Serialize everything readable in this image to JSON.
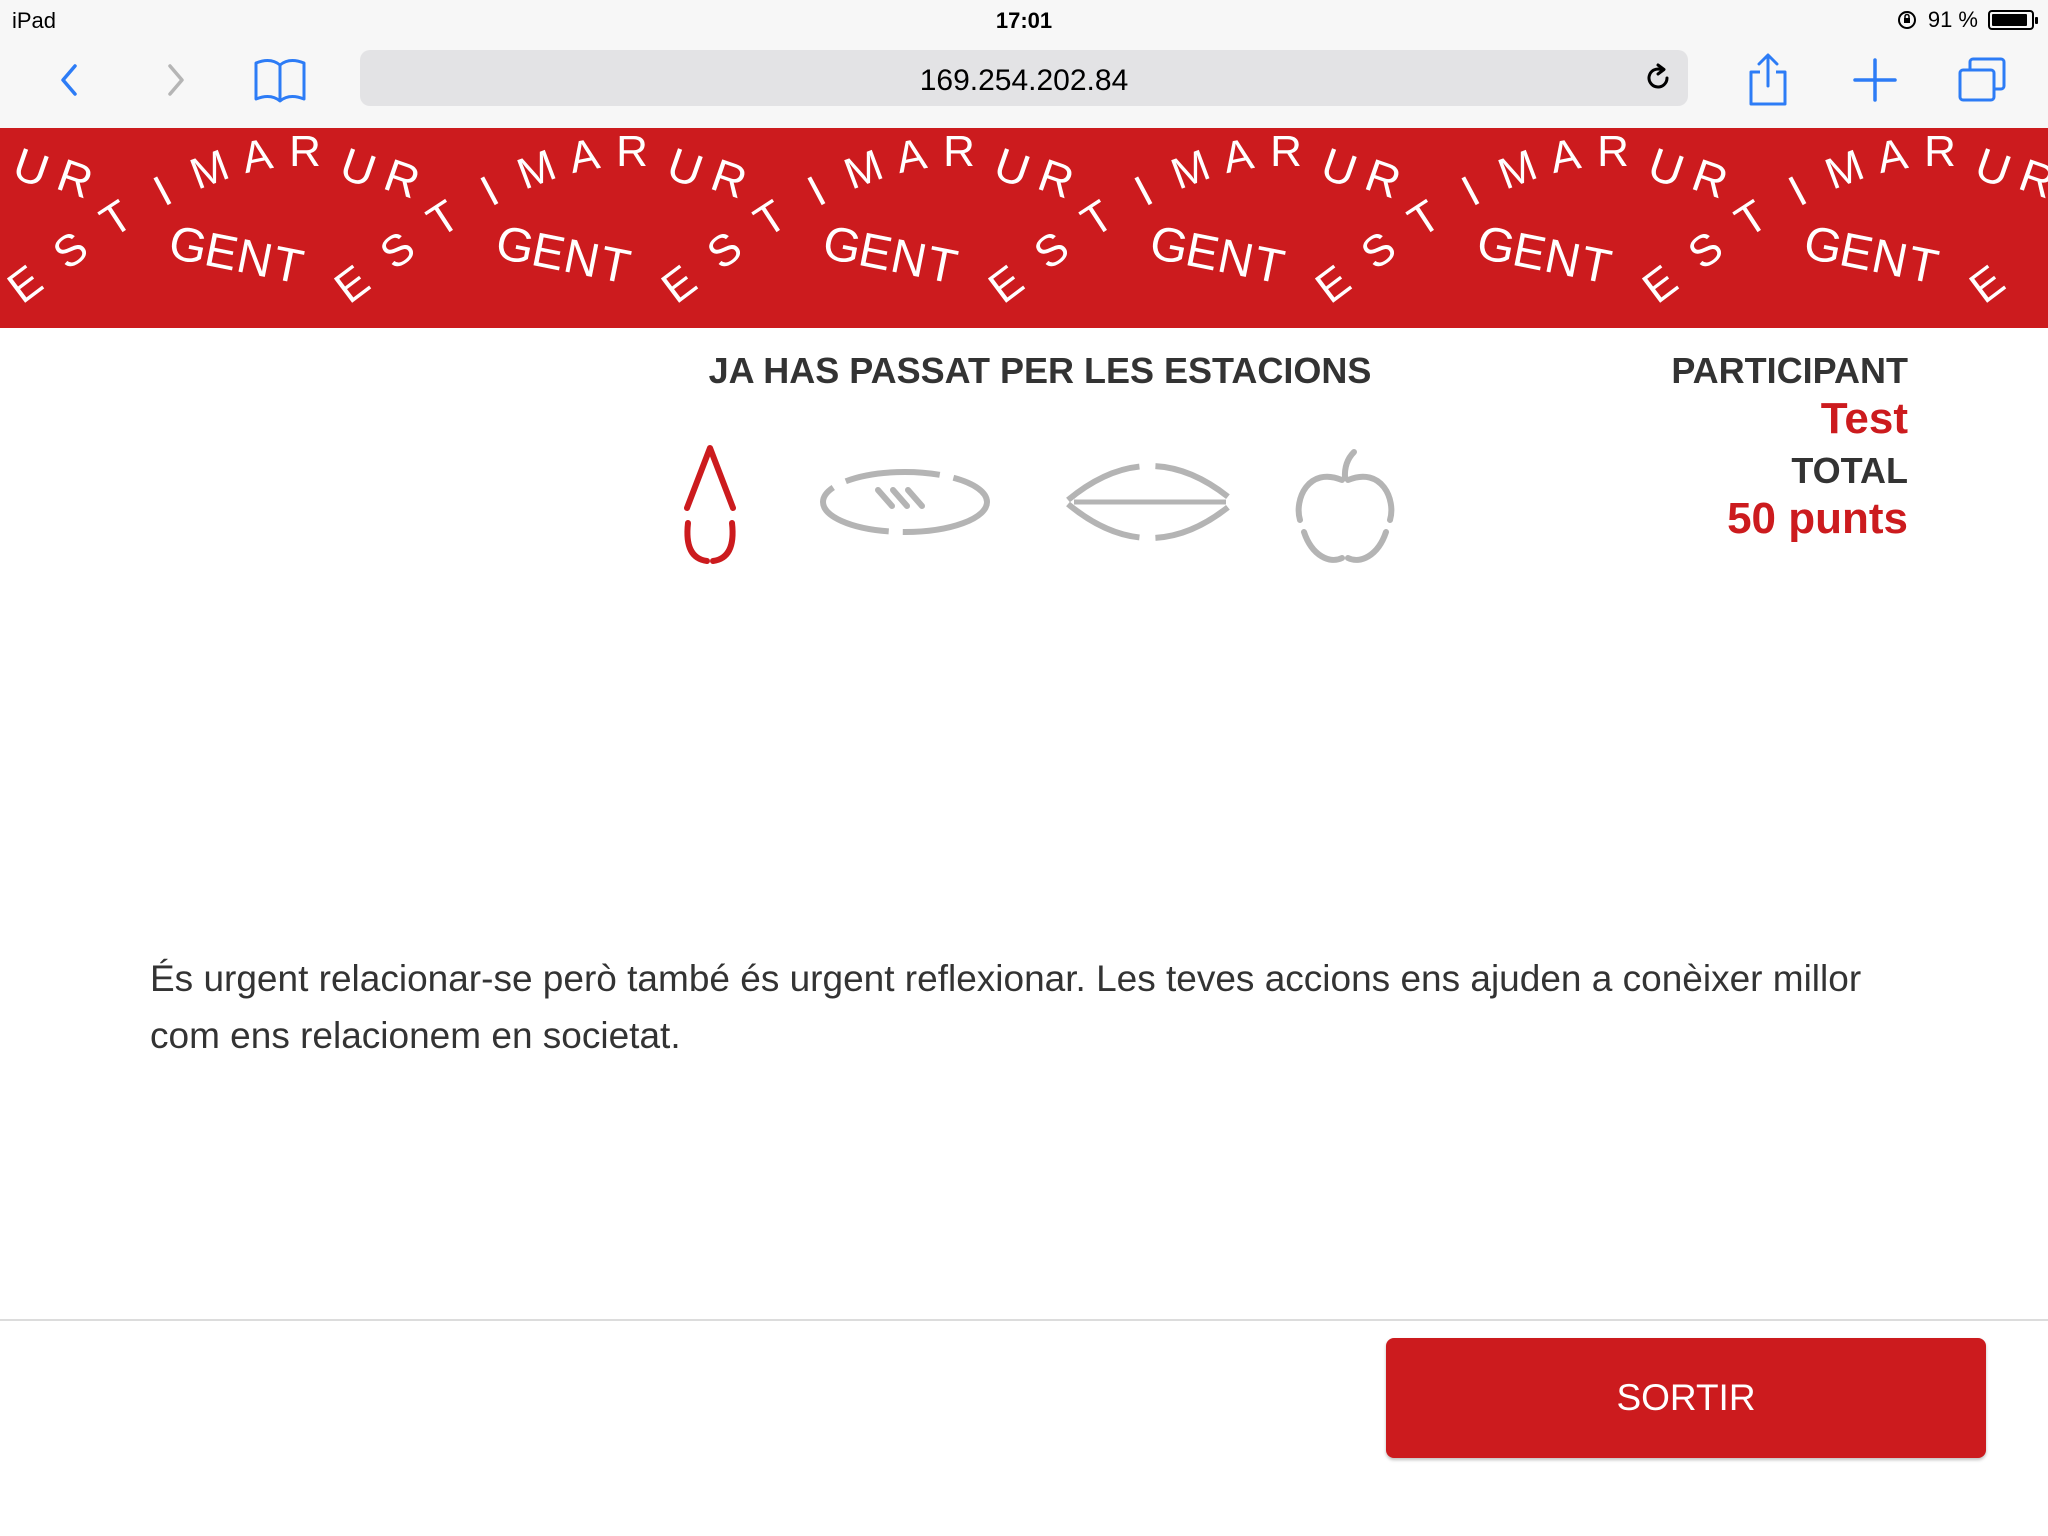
{
  "status_bar": {
    "device": "iPad",
    "time": "17:01",
    "battery": "91 %",
    "battery_level": 0.91
  },
  "browser": {
    "url": "169.254.202.84",
    "icons": [
      "back-icon",
      "forward-icon",
      "bookmarks-icon",
      "reload-icon",
      "share-icon",
      "new-tab-icon",
      "tabs-icon"
    ]
  },
  "banner": {
    "words": [
      "UR",
      "ESTIMAR",
      "GENT"
    ],
    "colors": {
      "background": "#cc1b1e",
      "text": "#ffffff"
    }
  },
  "stations": {
    "title": "JA HAS PASSAT PER LES ESTACIONS",
    "items": [
      {
        "icon": "drop-icon",
        "visited": true
      },
      {
        "icon": "bread-icon",
        "visited": false
      },
      {
        "icon": "eye-icon",
        "visited": false
      },
      {
        "icon": "apple-icon",
        "visited": false
      }
    ]
  },
  "participant": {
    "label": "PARTICIPANT",
    "name": "Test"
  },
  "total": {
    "label": "TOTAL",
    "value": "50 punts"
  },
  "message": "És urgent relacionar-se però també és urgent reflexionar. Les teves accions ens ajuden a conèixer millor com ens relacionem en societat.",
  "footer": {
    "exit_label": "SORTIR"
  },
  "colors": {
    "accent": "#cc1b1e",
    "inactive": "#b4b4b4",
    "ios_blue": "#2d7cf6"
  }
}
